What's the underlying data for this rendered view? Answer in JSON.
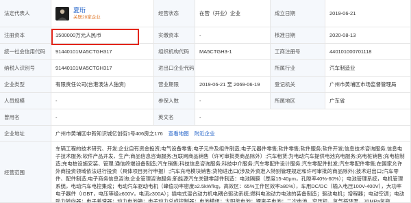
{
  "legal_rep": {
    "label": "法定代表人",
    "name": "夏珩",
    "related": "关联28家企业"
  },
  "status": {
    "label": "经营状态",
    "value": "在营（开业）企业"
  },
  "established": {
    "label": "成立日期",
    "value": "2019-06-21"
  },
  "reg_capital": {
    "label": "注册资本",
    "value": "1500000万元人民币"
  },
  "paid_capital": {
    "label": "实缴资本",
    "value": "-"
  },
  "approval_date": {
    "label": "核准日期",
    "value": "2020-08-13"
  },
  "credit_code": {
    "label": "统一社会信用代码",
    "value": "91440101MA5CTGH317"
  },
  "org_code": {
    "label": "组织机构代码",
    "value": "MA5CTGH3-1"
  },
  "biz_reg_no": {
    "label": "工商注册号",
    "value": "440101000701118"
  },
  "taxpayer_id": {
    "label": "纳税人识别号",
    "value": "91440101MA5CTGH317"
  },
  "import_export": {
    "label": "进出口企业代码",
    "value": ""
  },
  "industry": {
    "label": "所属行业",
    "value": "汽车制造业"
  },
  "company_type": {
    "label": "企业类型",
    "value": "有限责任公司(台港澳法人独资)"
  },
  "term": {
    "label": "营业期限",
    "value": "2019-06-21 至 2069-06-19"
  },
  "authority": {
    "label": "登记机关",
    "value": "广州市黄埔区市场监督管理局"
  },
  "staff": {
    "label": "人员规模",
    "value": "-"
  },
  "insured": {
    "label": "参保人数",
    "value": "-"
  },
  "region": {
    "label": "所属地区",
    "value": "广东省"
  },
  "former_name": {
    "label": "曾用名",
    "value": "-"
  },
  "english_name": {
    "label": "英文名",
    "value": "-"
  },
  "address": {
    "label": "企业地址",
    "value": "广州市黄埔区中新知识城亿创街1号406房之176",
    "map_link": "查看地图",
    "nearby_link": "附近企业"
  },
  "scope": {
    "label": "经营范围",
    "value": "车辆工程的技术研究、开发;企业自有资金投资;电气设备零售;电子元件及组件制造;电子元器件零售;软件零售;软件服务;软件开发;信息技术咨询服务;信息电子技术服务;软件产品开发、生产;商品信息咨询服务;互联网商品销售（许可审批类商品除外）;汽车租赁;为电动汽车提供电池充电服务;充电桩销售;充电桩制造;充电桩设施安装、管理;通信终端设备制造;汽车销售;科技信息咨询服务;科技中介服务;汽车零配件设计服务;汽车零配件批发;汽车零配件零售;在国家允许外商投资领域依法进行投资（具体项目另行申报）;汽车充电模块销售;货物进出口(涉及外资准入特别管理规定和许可审批的商品除外);技术进出口;汽车零件、配件制造;电子商务信息咨询;企业管理咨询服务;新能源汽车关键零部件制造：电池隔膜（厚度15-40μm，孔隙率40%-60%）；电池管理系统，电机管理系统，电动汽车电控集成；电动汽车驱动电机（峰值功率密度≥2.5kW/kg，高效区：65%工作区效率≥80%），车用DC/DC（输入电压100V-400V），大功率电子器件（IGBT，电压等级≥600V，电流≥300A）；插电式混合动力机电耦合驱动系统;燃料电池动力电池的装备制造；驱动电机；增程器；电动空调；电动助力转向器；电子差速器；动力电池箱；电子动力总成控制器；电池模组；太阳能电池；锂离子电池；二次电池、空压机、氢气循环泵、70MPa氢瓶"
  }
}
